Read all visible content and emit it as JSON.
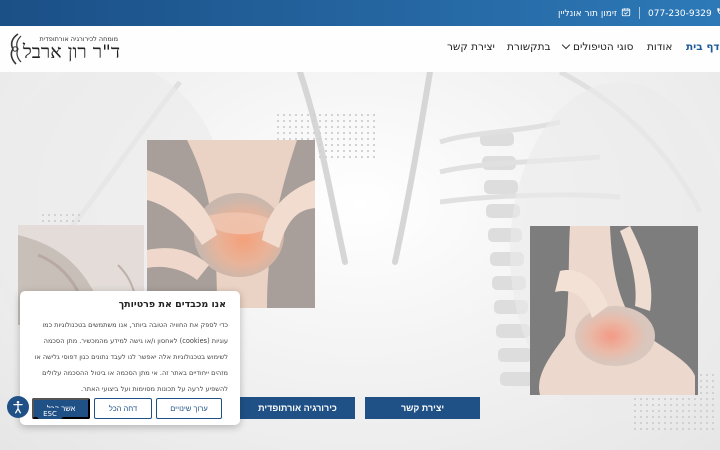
{
  "topbar": {
    "phone": "077-230-9329",
    "book_online": "זימון תור אונליין"
  },
  "logo": {
    "tagline": "מומחה לכירורגיה אורתופדית",
    "name": "ד\"ר רון ארבל"
  },
  "nav": {
    "home": "דף בית",
    "about": "אודות",
    "treatments": "סוגי הטיפולים",
    "media": "בתקשורת",
    "contact": "יצירת קשר"
  },
  "hero": {
    "cta_contact": "יצירת קשר",
    "cta_surgery": "כירורגיה אורתופדית"
  },
  "cookie": {
    "title": "אנו מכבדים את פרטיותך",
    "body": "כדי לספק את החוויה הטובה ביותר, אנו משתמשים בטכנולוגיות כמו עוגיות (cookies) לאחסון ו/או גישה למידע מהמכשיר. מתן הסכמה לשימוש בטכנולוגיות אלה יאפשר לנו לעבד נתונים כגון דפוסי גלישה או מזהים ייחודיים באתר זה. אי מתן הסכמה או ביטול ההסכמה עלולים להשפיע לרעה על תכונות מסוימות ועל ביצועי האתר.",
    "settings_label": "ערוך שינויים",
    "reject_label": "דחה הכל",
    "accept_label": "אשר הכל"
  },
  "accessibility": {
    "esc_label": "ESC"
  },
  "colors": {
    "primary": "#1f5187",
    "topbar_start": "#1b4f86",
    "topbar_end": "#2d79b8"
  }
}
